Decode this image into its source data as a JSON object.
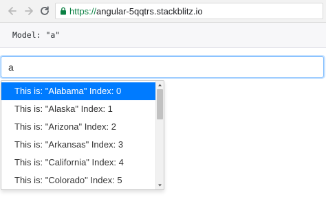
{
  "browser": {
    "url_scheme": "https://",
    "url_host": "angular-5qqtrs.stackblitz.io",
    "back_icon": "arrow-left-icon",
    "forward_icon": "arrow-right-icon",
    "reload_icon": "reload-icon",
    "lock_icon": "lock-icon",
    "secure_color": "#0b8043"
  },
  "model": {
    "text": "Model: \"a\""
  },
  "search": {
    "value": "a"
  },
  "dropdown": {
    "active_color": "#007bff",
    "items": [
      {
        "label": "This is: \"Alabama\" Index: 0"
      },
      {
        "label": "This is: \"Alaska\" Index: 1"
      },
      {
        "label": "This is: \"Arizona\" Index: 2"
      },
      {
        "label": "This is: \"Arkansas\" Index: 3"
      },
      {
        "label": "This is: \"California\" Index: 4"
      },
      {
        "label": "This is: \"Colorado\" Index: 5"
      }
    ]
  }
}
